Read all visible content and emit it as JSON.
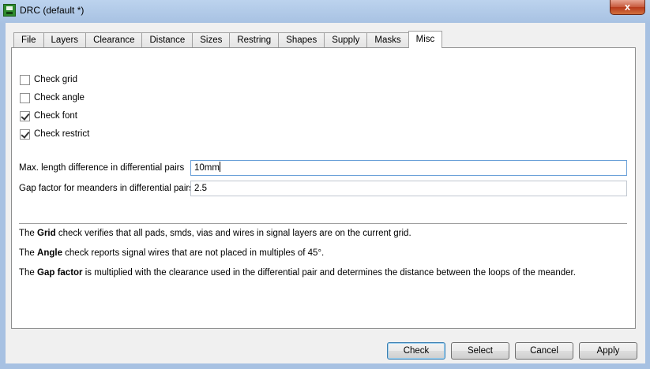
{
  "window": {
    "title": "DRC (default *)",
    "close_label": "x"
  },
  "tabs": [
    {
      "label": "File"
    },
    {
      "label": "Layers"
    },
    {
      "label": "Clearance"
    },
    {
      "label": "Distance"
    },
    {
      "label": "Sizes"
    },
    {
      "label": "Restring"
    },
    {
      "label": "Shapes"
    },
    {
      "label": "Supply"
    },
    {
      "label": "Masks"
    },
    {
      "label": "Misc",
      "active": true
    }
  ],
  "checkboxes": [
    {
      "label": "Check grid",
      "checked": false
    },
    {
      "label": "Check angle",
      "checked": false
    },
    {
      "label": "Check font",
      "checked": true
    },
    {
      "label": "Check restrict",
      "checked": true
    }
  ],
  "fields": {
    "max_length_label": "Max. length difference in differential pairs",
    "max_length_value": "10mm",
    "gap_factor_label": "Gap factor for meanders in differential pairs",
    "gap_factor_value": "2.5"
  },
  "info": {
    "grid_pre": "The ",
    "grid_bold": "Grid",
    "grid_post": " check verifies that all pads, smds, vias and wires in signal layers are on the current grid.",
    "angle_pre": "The ",
    "angle_bold": "Angle",
    "angle_post": " check reports signal wires that are not placed in multiples of 45°.",
    "gap_pre": "The ",
    "gap_bold": "Gap factor",
    "gap_post": " is multiplied with the clearance used in the differential pair and determines the distance between the loops of the meander."
  },
  "buttons": {
    "check": "Check",
    "select": "Select",
    "cancel": "Cancel",
    "apply": "Apply"
  }
}
